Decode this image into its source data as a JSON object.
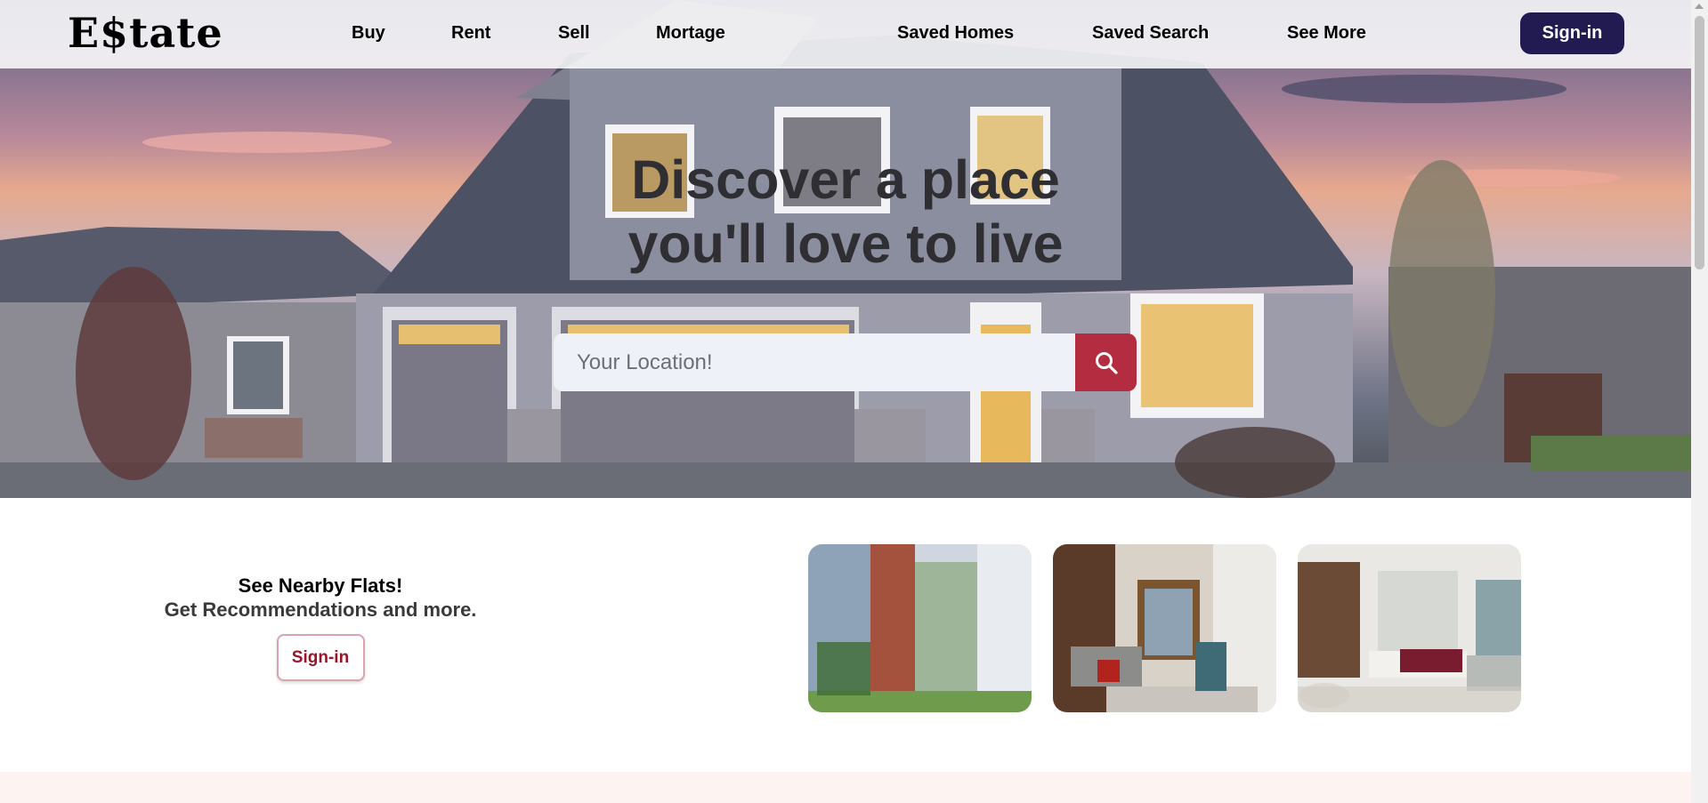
{
  "brand": {
    "logo_text": "E$tate"
  },
  "nav": {
    "links": [
      {
        "label": "Buy"
      },
      {
        "label": "Rent"
      },
      {
        "label": "Sell"
      },
      {
        "label": "Mortage"
      },
      {
        "label": "Saved Homes"
      },
      {
        "label": "Saved Search"
      },
      {
        "label": "See More"
      }
    ],
    "signin_label": "Sign-in"
  },
  "hero": {
    "headline_line1": "Discover a place",
    "headline_line2": "you'll love to live",
    "search": {
      "placeholder": "Your Location!",
      "value": "",
      "button_icon": "search-icon"
    }
  },
  "promo": {
    "title": "See Nearby Flats!",
    "subtitle": "Get Recommendations and more.",
    "signin_label": "Sign-in"
  },
  "gallery": [
    {
      "icon": "balcony-photo"
    },
    {
      "icon": "living-room-photo"
    },
    {
      "icon": "open-plan-lounge-photo"
    }
  ],
  "colors": {
    "nav_signin_bg": "#221b52",
    "search_button_bg": "#b42c40",
    "promo_signin_text": "#9c1327",
    "bottom_band_bg": "#fdf3f1"
  }
}
